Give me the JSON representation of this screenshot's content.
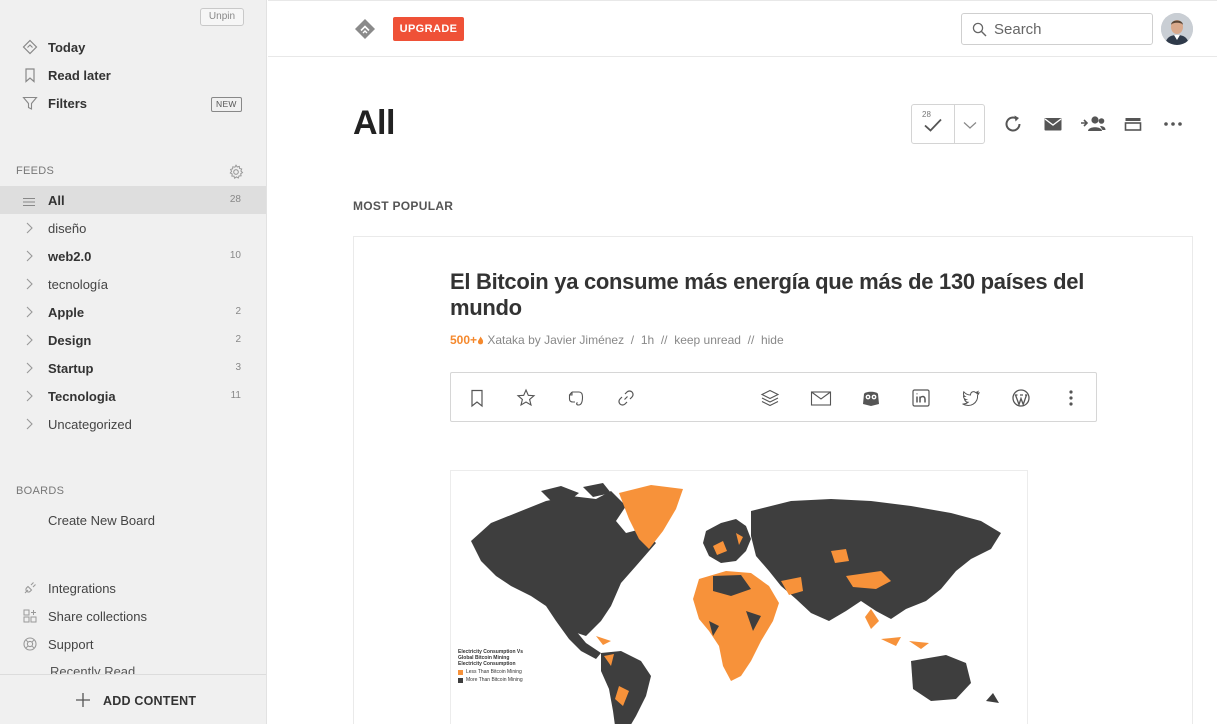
{
  "sidebar": {
    "unpin_label": "Unpin",
    "top_items": [
      {
        "label": "Today",
        "icon": "today-diamond-icon"
      },
      {
        "label": "Read later",
        "icon": "bookmark-icon"
      },
      {
        "label": "Filters",
        "icon": "filter-icon",
        "badge": "NEW"
      }
    ],
    "feeds_label": "FEEDS",
    "feeds": [
      {
        "label": "All",
        "count": "28",
        "bold": true,
        "active": true
      },
      {
        "label": "diseño",
        "count": "",
        "bold": false
      },
      {
        "label": "web2.0",
        "count": "10",
        "bold": true
      },
      {
        "label": "tecnología",
        "count": "",
        "bold": false
      },
      {
        "label": "Apple",
        "count": "2",
        "bold": true
      },
      {
        "label": "Design",
        "count": "2",
        "bold": true
      },
      {
        "label": "Startup",
        "count": "3",
        "bold": true
      },
      {
        "label": "Tecnologia",
        "count": "11",
        "bold": true
      },
      {
        "label": "Uncategorized",
        "count": "",
        "bold": false
      }
    ],
    "boards_label": "BOARDS",
    "create_board": "Create New Board",
    "bottom_items": [
      {
        "label": "Integrations",
        "icon": "plug-icon"
      },
      {
        "label": "Share collections",
        "icon": "share-collections-icon"
      },
      {
        "label": "Support",
        "icon": "lifebuoy-icon"
      }
    ],
    "recently_read": "Recently Read",
    "add_content": "ADD CONTENT"
  },
  "topbar": {
    "upgrade_label": "UPGRADE",
    "search_placeholder": "Search"
  },
  "main": {
    "title": "All",
    "unread_count": "28",
    "section_label": "MOST POPULAR"
  },
  "article": {
    "title": "El Bitcoin ya consume más energía que más de 130 países del mundo",
    "popularity": "500+",
    "source": "Xataka by Javier Jiménez",
    "age": "1h",
    "keep_unread": "keep unread",
    "hide": "hide",
    "map_legend": {
      "title_line1": "Electricity Consumption Vs",
      "title_line2": "Global Bitcoin Mining",
      "title_line3": "Electricity Consumption",
      "less": "Less Than Bitcoin Mining",
      "more": "More Than Bitcoin Mining"
    }
  },
  "colors": {
    "accent": "#ef5137",
    "popularity": "#f5892d",
    "map_less": "#f7923a",
    "map_more": "#3e3e3e"
  }
}
